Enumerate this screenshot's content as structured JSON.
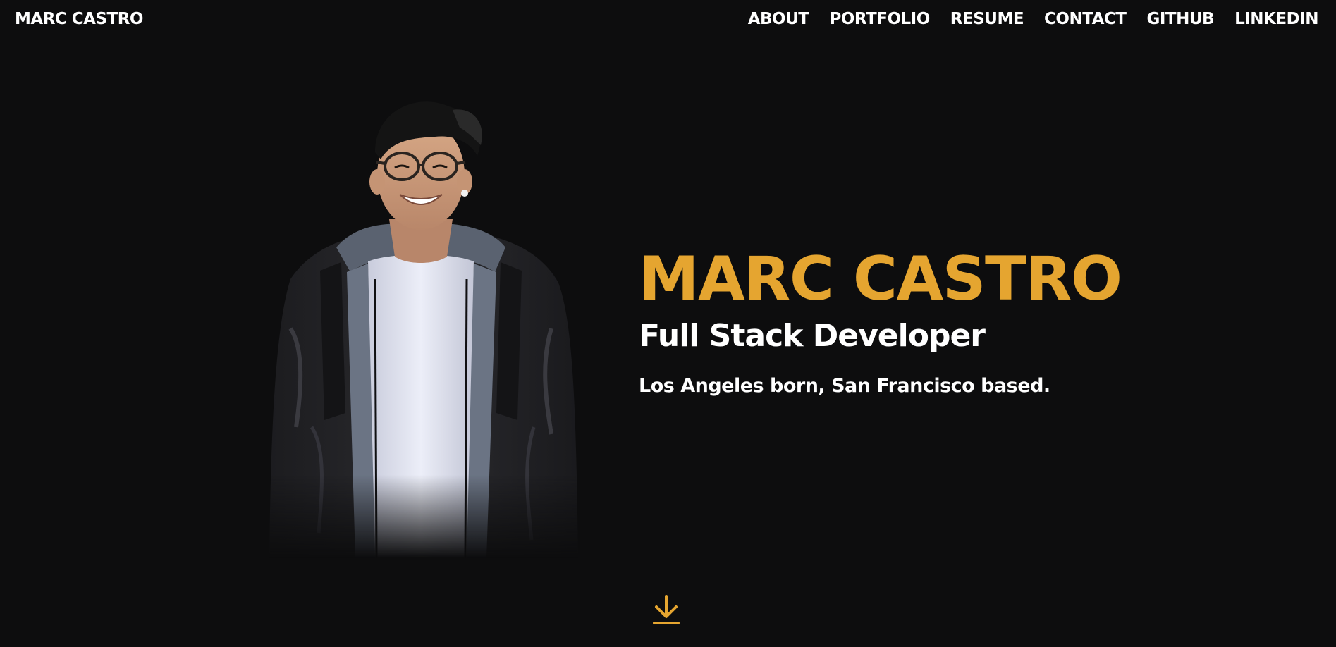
{
  "header": {
    "brand": "MARC CASTRO",
    "nav": [
      {
        "label": "ABOUT"
      },
      {
        "label": "PORTFOLIO"
      },
      {
        "label": "RESUME"
      },
      {
        "label": "CONTACT"
      },
      {
        "label": "GITHUB"
      },
      {
        "label": "LINKEDIN"
      }
    ]
  },
  "hero": {
    "name": "MARC CASTRO",
    "role": "Full Stack Developer",
    "tagline": "Los Angeles born, San Francisco based."
  },
  "icons": {
    "scroll": "download-arrow-icon"
  },
  "colors": {
    "background": "#0d0d0e",
    "accent": "#e5a530",
    "text": "#ffffff"
  }
}
